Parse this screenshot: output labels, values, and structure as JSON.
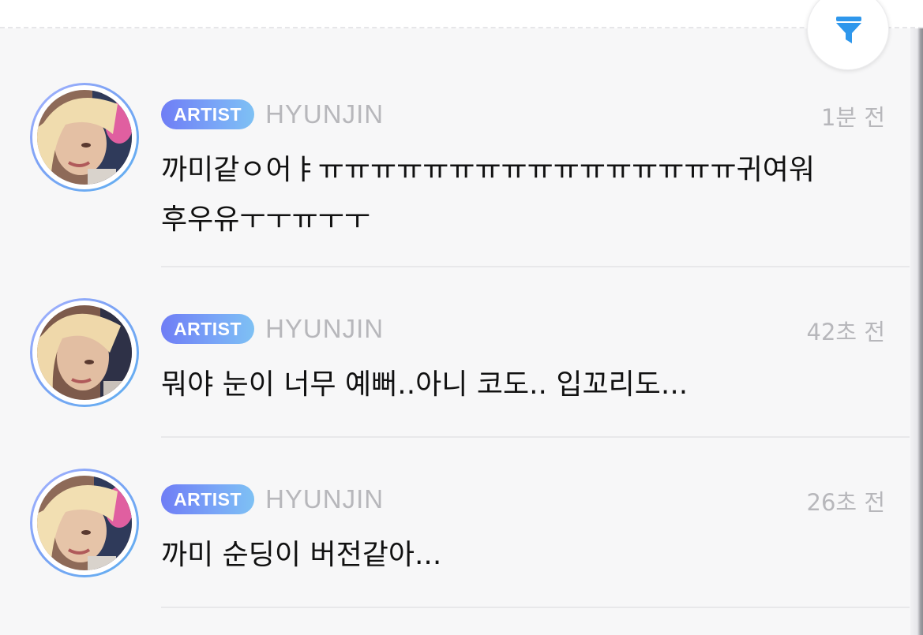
{
  "header": {
    "filter_icon": "filter-funnel-icon",
    "accent_color": "#2e97ec"
  },
  "posts": [
    {
      "badge": "ARTIST",
      "author": "HYUNJIN",
      "time": "1분 전",
      "message": "까미같ㅇ어ㅑㅠㅠㅠㅠㅠㅠㅠㅠㅠㅠㅠㅠㅠㅠㅠㅠ귀여워\n후우유ㅜㅜㅠㅜㅜ",
      "avatar": "artist-profile-photo"
    },
    {
      "badge": "ARTIST",
      "author": "HYUNJIN",
      "time": "42초 전",
      "message": "뭐야 눈이 너무 예뻐..아니 코도.. 입꼬리도...",
      "avatar": "artist-profile-photo"
    },
    {
      "badge": "ARTIST",
      "author": "HYUNJIN",
      "time": "26초 전",
      "message": "까미 순딩이 버전같아...",
      "avatar": "artist-profile-photo"
    }
  ]
}
